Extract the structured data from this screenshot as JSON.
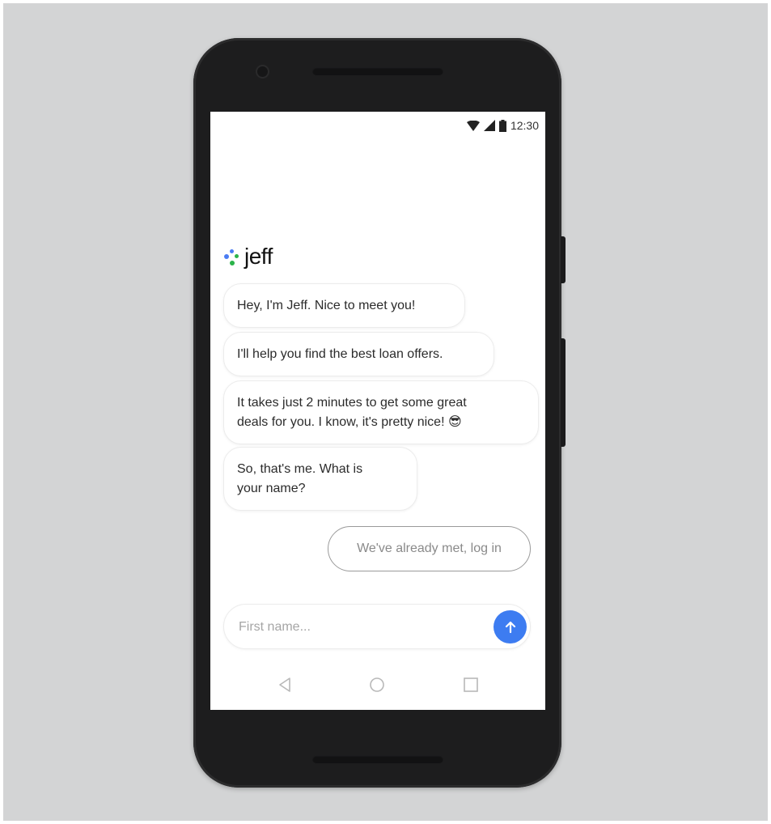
{
  "status_bar": {
    "time": "12:30",
    "icons": [
      "wifi-icon",
      "cellular-signal-icon",
      "battery-icon"
    ]
  },
  "app": {
    "logo_text": "jeff",
    "logo_dot_colors": [
      "#4a7cf3",
      "#2bb34a"
    ]
  },
  "chat": {
    "messages": [
      "Hey, I'm Jeff. Nice to meet you!",
      "I'll help you find the best loan offers.",
      "It takes just 2 minutes to get some great\ndeals for you. I know, it's pretty nice! 😎",
      "So, that's me. What is\nyour name?"
    ],
    "login_button_label": "We've already met, log in"
  },
  "composer": {
    "placeholder": "First name...",
    "value": "",
    "send_icon": "arrow-up-icon",
    "send_color": "#3d7cf1"
  },
  "nav_bar": {
    "icons": [
      "back-icon",
      "home-icon",
      "recents-icon"
    ]
  }
}
